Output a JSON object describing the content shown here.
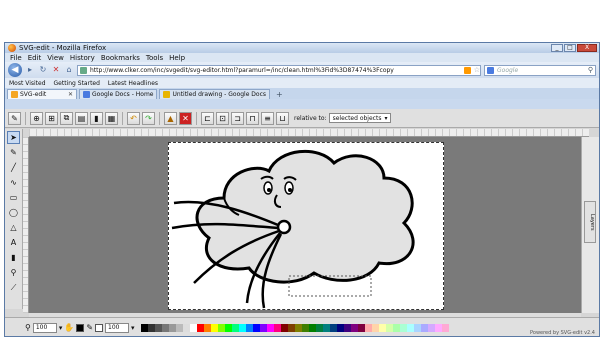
{
  "window": {
    "title": "SVG-edit - Mozilla Firefox",
    "controls": [
      "_",
      "□",
      "X"
    ]
  },
  "menu": [
    "File",
    "Edit",
    "View",
    "History",
    "Bookmarks",
    "Tools",
    "Help"
  ],
  "nav": {
    "url": "http://www.clker.com/inc/svgedit/svg-editor.html?paramurl=/inc/clean.html%3Fid%3D87474%3Fcopy",
    "search_placeholder": "Google"
  },
  "bookmarks": [
    "Most Visited",
    "Getting Started",
    "Latest Headlines"
  ],
  "tabs": [
    {
      "label": "SVG-edit",
      "active": true
    },
    {
      "label": "Google Docs - Home",
      "active": false
    },
    {
      "label": "Untitled drawing - Google Docs",
      "active": false
    }
  ],
  "toolbar": {
    "relative_label": "relative to:",
    "relative_value": "selected objects"
  },
  "left_tools": [
    "select",
    "pencil",
    "line",
    "freehand",
    "rect",
    "ellipse",
    "path",
    "text",
    "image",
    "zoom",
    "eyedropper"
  ],
  "layers_label": "Layers",
  "bottom": {
    "zoom": "100",
    "stroke_width": "100",
    "powered_by": "Powered by SVG-edit v2.4"
  },
  "palette": [
    "#000000",
    "#333333",
    "#555555",
    "#777777",
    "#999999",
    "#bbbbbb",
    "#dddddd",
    "#ffffff",
    "#ff0000",
    "#ff7f00",
    "#ffff00",
    "#7fff00",
    "#00ff00",
    "#00ff7f",
    "#00ffff",
    "#007fff",
    "#0000ff",
    "#7f00ff",
    "#ff00ff",
    "#ff007f",
    "#7f0000",
    "#7f3f00",
    "#7f7f00",
    "#3f7f00",
    "#007f00",
    "#007f3f",
    "#007f7f",
    "#003f7f",
    "#00007f",
    "#3f007f",
    "#7f007f",
    "#7f003f",
    "#ffaaaa",
    "#ffd4aa",
    "#ffffaa",
    "#d4ffaa",
    "#aaffaa",
    "#aaffd4",
    "#aaffff",
    "#aad4ff",
    "#aaaaff",
    "#d4aaff",
    "#ffaaff",
    "#ffaad4"
  ]
}
